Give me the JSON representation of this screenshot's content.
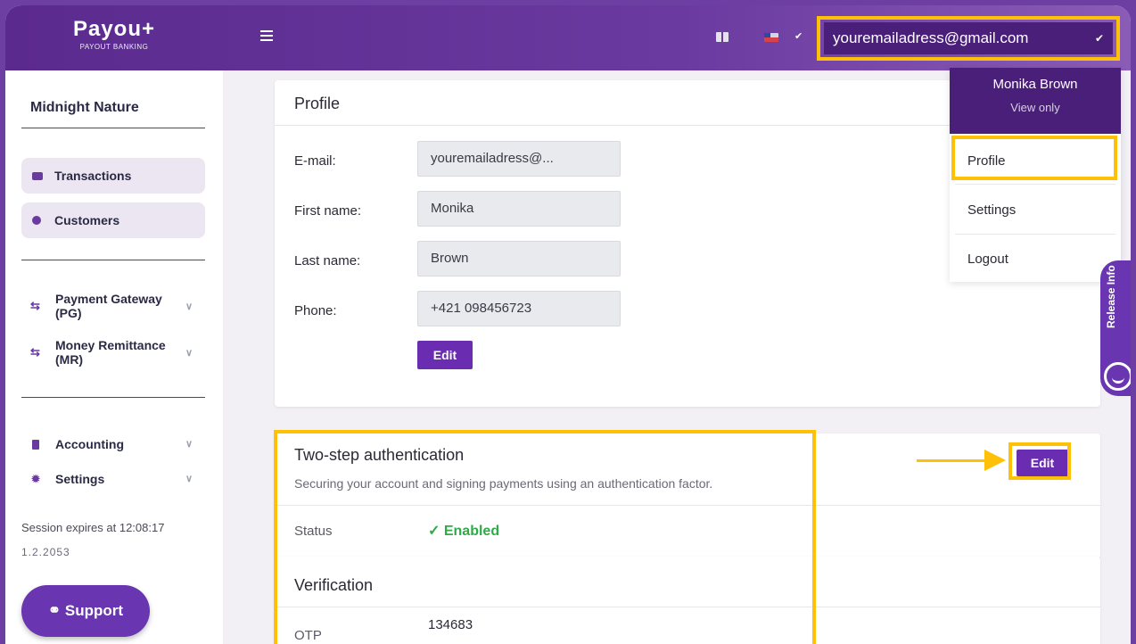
{
  "header": {
    "logo_main": "Payou+",
    "logo_sub": "PAYOUT BANKING",
    "user_email": "youremailadress@gmail.com"
  },
  "sidebar": {
    "org_name": "Midnight Nature",
    "pills": [
      {
        "label": "Transactions",
        "icon": "card-icon"
      },
      {
        "label": "Customers",
        "icon": "user-icon"
      }
    ],
    "groups": [
      {
        "label_line1": "Payment Gateway",
        "label_line2": "(PG)",
        "icon": "transfer-arrows-icon"
      },
      {
        "label_line1": "Money Remittance",
        "label_line2": "(MR)",
        "icon": "transfer-arrows-icon"
      }
    ],
    "menus": [
      {
        "label": "Accounting",
        "icon": "document-icon"
      },
      {
        "label": "Settings",
        "icon": "gear-icon"
      }
    ],
    "session": "Session expires at 12:08:17",
    "version": "1.2.2053",
    "support_label": "Support"
  },
  "profile": {
    "title": "Profile",
    "fields": [
      {
        "label": "E-mail:",
        "value": "youremailadress@..."
      },
      {
        "label": "First name:",
        "value": "Monika"
      },
      {
        "label": "Last name:",
        "value": "Brown"
      },
      {
        "label": "Phone:",
        "value": "+421 098456723"
      }
    ],
    "edit_label": "Edit"
  },
  "two_step": {
    "title": "Two-step authentication",
    "subtitle": "Securing your account and signing payments using an authentication factor.",
    "edit_label": "Edit",
    "status_label": "Status",
    "status_value": "Enabled",
    "status_color": "#2eaa4a"
  },
  "verification": {
    "title": "Verification",
    "otp_label": "OTP",
    "otp_value": "134683"
  },
  "dropdown": {
    "name": "Monika Brown",
    "role": "View only",
    "items": [
      "Profile",
      "Settings",
      "Logout"
    ]
  },
  "release_info": "Release Info",
  "colors": {
    "brand": "#6a35b0",
    "highlight": "#ffc107"
  }
}
